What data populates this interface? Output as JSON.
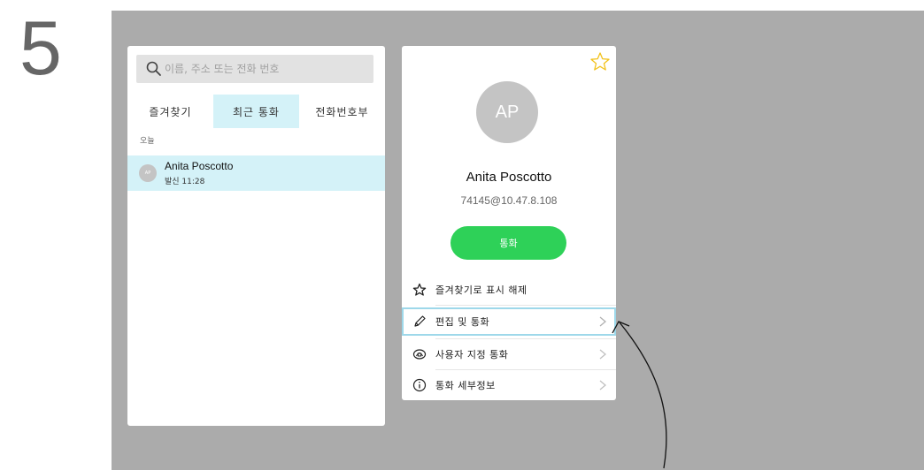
{
  "step": {
    "number": "5"
  },
  "search": {
    "placeholder": "이름, 주소 또는 전화 번호"
  },
  "tabs": [
    {
      "label": "즐겨찾기",
      "active": false
    },
    {
      "label": "최근 통화",
      "active": true
    },
    {
      "label": "전화번호부",
      "active": false
    }
  ],
  "recents": {
    "section_label": "오늘",
    "items": [
      {
        "initials": "AP",
        "name": "Anita Poscotto",
        "detail": "발신 11:28"
      }
    ]
  },
  "contact": {
    "initials": "AP",
    "name": "Anita Poscotto",
    "address": "74145@10.47.8.108",
    "call_label": "통화",
    "menu": [
      {
        "label": "즐겨찾기로 표시 해제",
        "icon": "star-icon"
      },
      {
        "label": "편집 및 통화",
        "icon": "pencil-icon"
      },
      {
        "label": "사용자 지정 통화",
        "icon": "custom-call-icon"
      },
      {
        "label": "통화 세부정보",
        "icon": "info-icon"
      }
    ]
  },
  "colors": {
    "screen_bg": "#ababab",
    "active_tab": "#d4f2f8",
    "call_green": "#2ed158",
    "star_yellow": "#f2c21b",
    "highlight_border": "#9ed8ea"
  }
}
